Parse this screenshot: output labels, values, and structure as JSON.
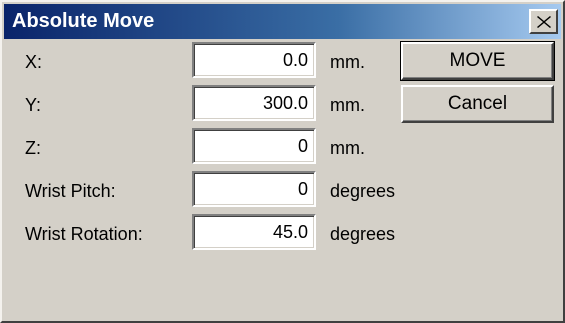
{
  "window": {
    "title": "Absolute Move",
    "close_icon": "close-icon"
  },
  "fields": [
    {
      "label": "X:",
      "value": "0.0",
      "unit": "mm."
    },
    {
      "label": "Y:",
      "value": "300.0",
      "unit": "mm."
    },
    {
      "label": "Z:",
      "value": "0",
      "unit": "mm."
    },
    {
      "label": "Wrist Pitch:",
      "value": "0",
      "unit": "degrees"
    },
    {
      "label": "Wrist Rotation:",
      "value": "45.0",
      "unit": "degrees"
    }
  ],
  "buttons": {
    "move_label": "MOVE",
    "cancel_label": "Cancel"
  },
  "colors": {
    "dialog_face": "#d4d0c8",
    "title_start": "#0a246a",
    "title_end": "#a6caf0"
  }
}
